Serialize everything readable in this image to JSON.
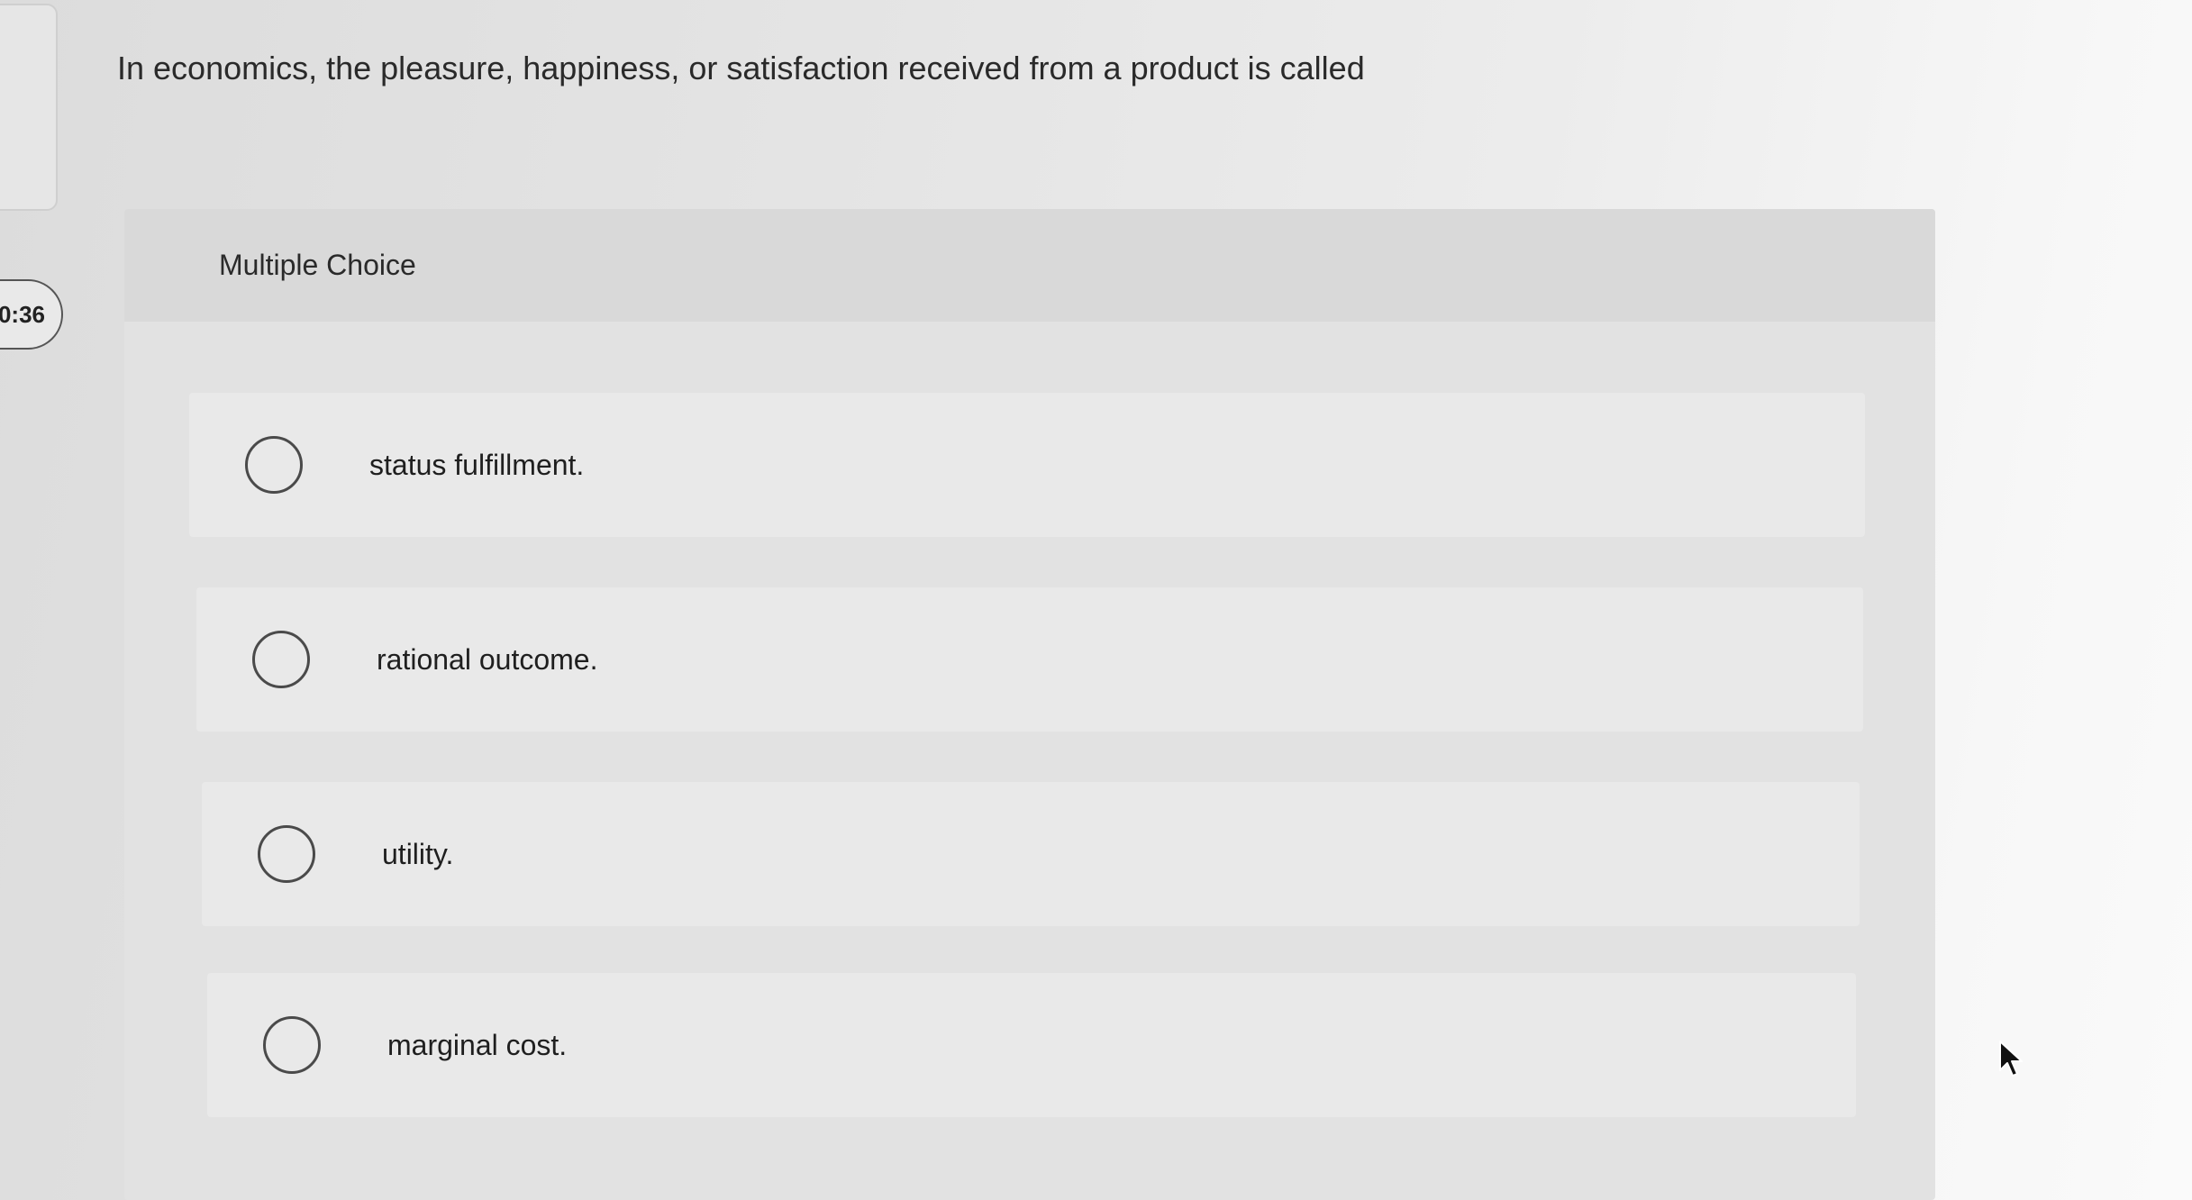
{
  "timer": {
    "text": "0:36"
  },
  "question": {
    "text": "In economics, the pleasure, happiness, or satisfaction received from a product is called"
  },
  "panel": {
    "title": "Multiple Choice",
    "options": [
      {
        "label": "status fulfillment."
      },
      {
        "label": "rational outcome."
      },
      {
        "label": "utility."
      },
      {
        "label": "marginal cost."
      }
    ]
  },
  "icons": {
    "radio": "radio-button-icon",
    "cursor": "mouse-pointer-icon"
  }
}
